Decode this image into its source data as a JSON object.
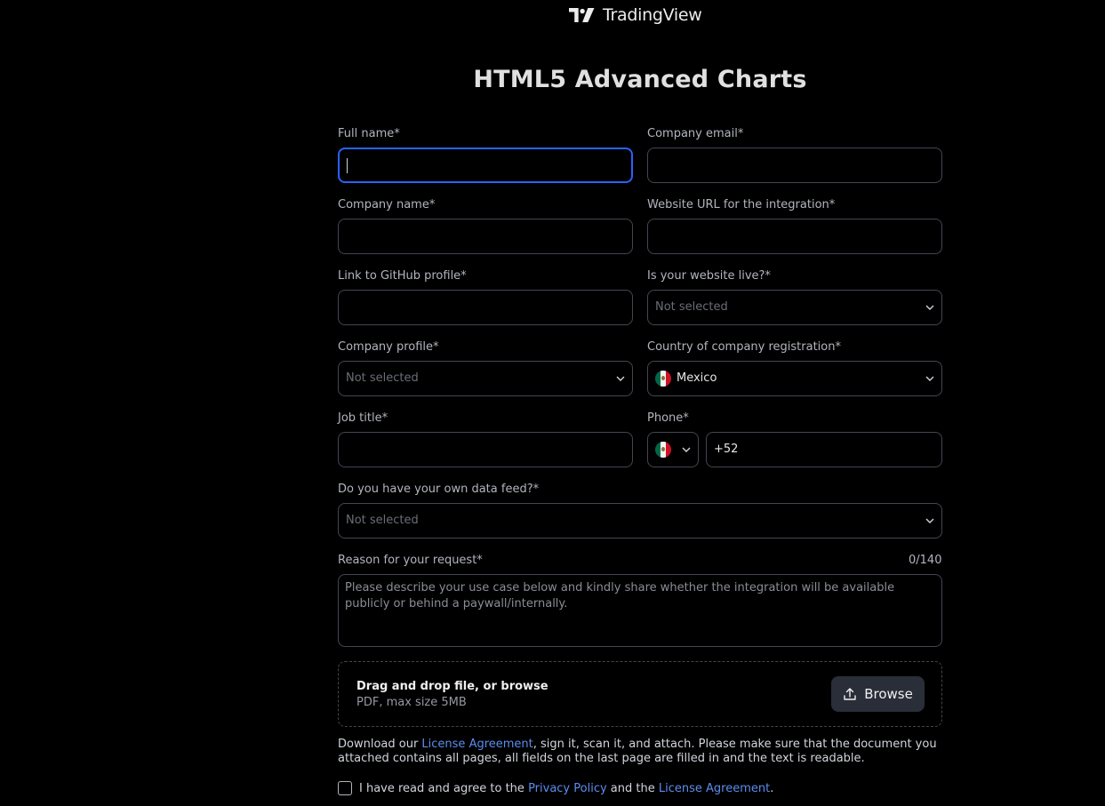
{
  "brand": {
    "name": "TradingView"
  },
  "page": {
    "title": "HTML5 Advanced Charts"
  },
  "form": {
    "full_name": {
      "label": "Full name*",
      "value": ""
    },
    "company_email": {
      "label": "Company email*",
      "value": ""
    },
    "company_name": {
      "label": "Company name*",
      "value": ""
    },
    "website_url": {
      "label": "Website URL for the integration*",
      "value": ""
    },
    "github": {
      "label": "Link to GitHub profile*",
      "value": ""
    },
    "website_live": {
      "label": "Is your website live?*",
      "selected": "Not selected"
    },
    "company_profile": {
      "label": "Company profile*",
      "selected": "Not selected"
    },
    "country": {
      "label": "Country of company registration*",
      "selected": "Mexico",
      "flag_icon": "mexico-flag-icon"
    },
    "job_title": {
      "label": "Job title*",
      "value": ""
    },
    "phone": {
      "label": "Phone*",
      "code": "+52",
      "flag_icon": "mexico-flag-icon"
    },
    "data_feed": {
      "label": "Do you have your own data feed?*",
      "selected": "Not selected"
    },
    "reason": {
      "label": "Reason for your request*",
      "counter": "0/140",
      "placeholder": "Please describe your use case below and kindly share whether the integration will be available publicly or behind a paywall/internally."
    }
  },
  "upload": {
    "title": "Drag and drop file, or browse",
    "hint": "PDF, max size 5MB",
    "button_label": "Browse",
    "button_icon": "upload-icon"
  },
  "notice": {
    "prefix": "Download our ",
    "link": "License Agreement",
    "suffix": ", sign it, scan it, and attach. Please make sure that the document you attached contains all pages, all fields on the last page are filled in and the text is readable."
  },
  "agreement": {
    "prefix": "I have read and agree to the ",
    "privacy_link": "Privacy Policy",
    "middle": " and the ",
    "license_link": "License Agreement",
    "suffix": "."
  },
  "colors": {
    "background": "#000000",
    "focus": "#2962ff",
    "link": "#5b8def",
    "border": "#434651",
    "button": "#2a2e39"
  }
}
